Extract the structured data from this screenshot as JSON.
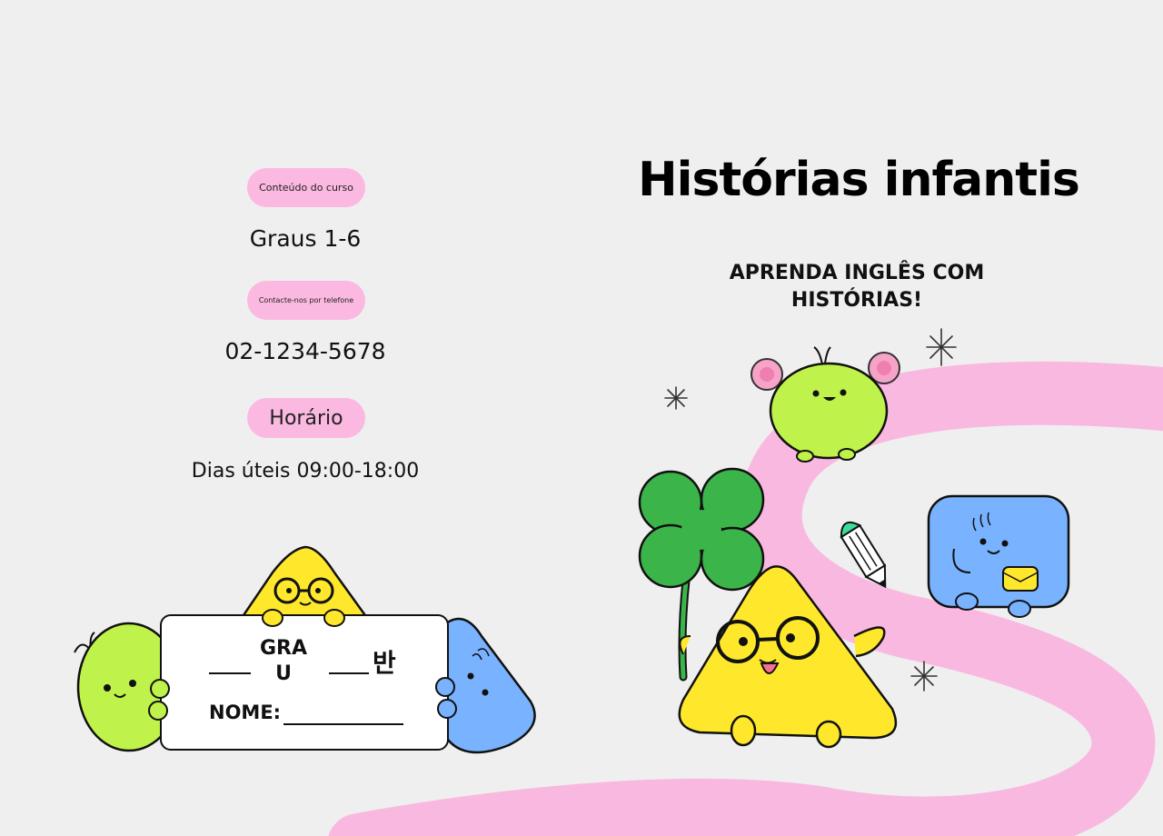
{
  "info": {
    "course_label": "Conteúdo do curso",
    "course_value": "Graus 1-6",
    "phone_label": "Contacte-nos por telefone",
    "phone_value": "02-1234-5678",
    "hours_label": "Horário",
    "hours_value": "Dias úteis 09:00-18:00"
  },
  "cover": {
    "title": "Histórias infantis",
    "subtitle": "APRENDA INGLÊS COM HISTÓRIAS!"
  },
  "name_card": {
    "grade_label": "GRAU",
    "class_label": "반",
    "name_label": "NOME:"
  },
  "colors": {
    "background": "#efefef",
    "pill_pink": "#fbb9e1",
    "ribbon_pink": "#f9b8e0",
    "character_green": "#bff24a",
    "character_yellow": "#ffe82c",
    "character_blue": "#79b2ff",
    "clover_green": "#3bb54a"
  },
  "illustrations": {
    "left": [
      "green-blob-character",
      "yellow-triangle-character",
      "blue-blob-character",
      "name-card"
    ],
    "right": [
      "pink-ribbon",
      "green-blob-character-with-pompoms",
      "clover-icon",
      "yellow-triangle-character-with-glasses",
      "pencil-icon",
      "blue-square-character",
      "sparkle-icon"
    ]
  }
}
